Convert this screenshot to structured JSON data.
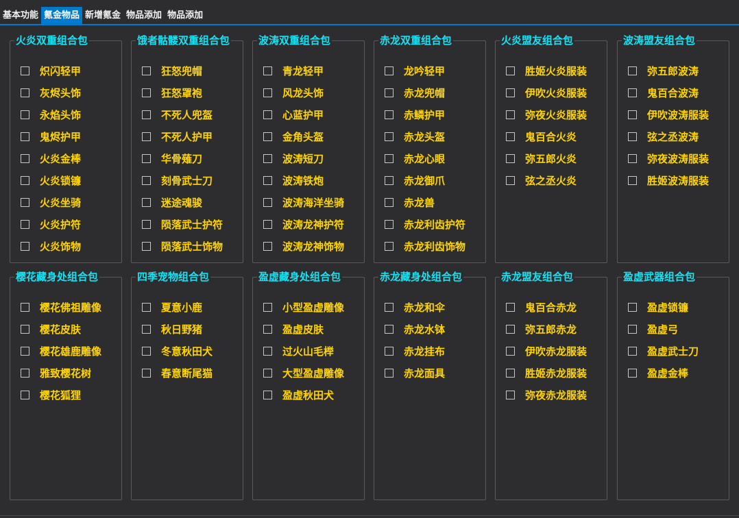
{
  "tabs": [
    {
      "label": "基本功能",
      "active": false
    },
    {
      "label": "氪金物品",
      "active": true
    },
    {
      "label": "新增氪金",
      "active": false
    },
    {
      "label": "物品添加",
      "active": false
    },
    {
      "label": "物品添加",
      "active": false
    }
  ],
  "groups": [
    {
      "title": "火炎双重组合包",
      "items": [
        "炽闪轻甲",
        "灰烬头饰",
        "永焰头饰",
        "鬼烬护甲",
        "火炎金棒",
        "火炎锁镰",
        "火炎坐骑",
        "火炎护符",
        "火炎饰物"
      ]
    },
    {
      "title": "饿者骷髅双重组合包",
      "items": [
        "狂怒兜帽",
        "狂怒罩袍",
        "不死人兜盔",
        "不死人护甲",
        "华骨薙刀",
        "刻骨武士刀",
        "迷途魂骏",
        "陨落武士护符",
        "陨落武士饰物"
      ]
    },
    {
      "title": "波涛双重组合包",
      "items": [
        "青龙轻甲",
        "风龙头饰",
        "心蓝护甲",
        "金角头盔",
        "波涛短刀",
        "波涛铁炮",
        "波涛海洋坐骑",
        "波涛龙神护符",
        "波涛龙神饰物"
      ]
    },
    {
      "title": "赤龙双重组合包",
      "items": [
        "龙吟轻甲",
        "赤龙兜帽",
        "赤鳞护甲",
        "赤龙头盔",
        "赤龙心眼",
        "赤龙御爪",
        "赤龙兽",
        "赤龙利齿护符",
        "赤龙利齿饰物"
      ]
    },
    {
      "title": "火炎盟友组合包",
      "items": [
        "胜姬火炎服装",
        "伊吹火炎服装",
        "弥夜火炎服装",
        "鬼百合火炎",
        "弥五郎火炎",
        "弦之丞火炎"
      ]
    },
    {
      "title": "波涛盟友组合包",
      "items": [
        "弥五郎波涛",
        "鬼百合波涛",
        "伊吹波涛服装",
        "弦之丞波涛",
        "弥夜波涛服装",
        "胜姬波涛服装"
      ]
    },
    {
      "title": "樱花藏身处组合包",
      "items": [
        "樱花佛祖雕像",
        "樱花皮肤",
        "樱花雄鹿雕像",
        "雅致樱花树",
        "樱花狐狸"
      ]
    },
    {
      "title": "四季宠物组合包",
      "items": [
        "夏意小鹿",
        "秋日野猪",
        "冬意秋田犬",
        "春意断尾猫"
      ]
    },
    {
      "title": "盈虚藏身处组合包",
      "items": [
        "小型盈虚雕像",
        "盈虚皮肤",
        "过火山毛榉",
        "大型盈虚雕像",
        "盈虚秋田犬"
      ]
    },
    {
      "title": "赤龙藏身处组合包",
      "items": [
        "赤龙和伞",
        "赤龙水钵",
        "赤龙挂布",
        "赤龙面具"
      ]
    },
    {
      "title": "赤龙盟友组合包",
      "items": [
        "鬼百合赤龙",
        "弥五郎赤龙",
        "伊吹赤龙服装",
        "胜姬赤龙服装",
        "弥夜赤龙服装"
      ]
    },
    {
      "title": "盈虚武器组合包",
      "items": [
        "盈虚锁镰",
        "盈虚弓",
        "盈虚武士刀",
        "盈虚金棒"
      ]
    }
  ]
}
